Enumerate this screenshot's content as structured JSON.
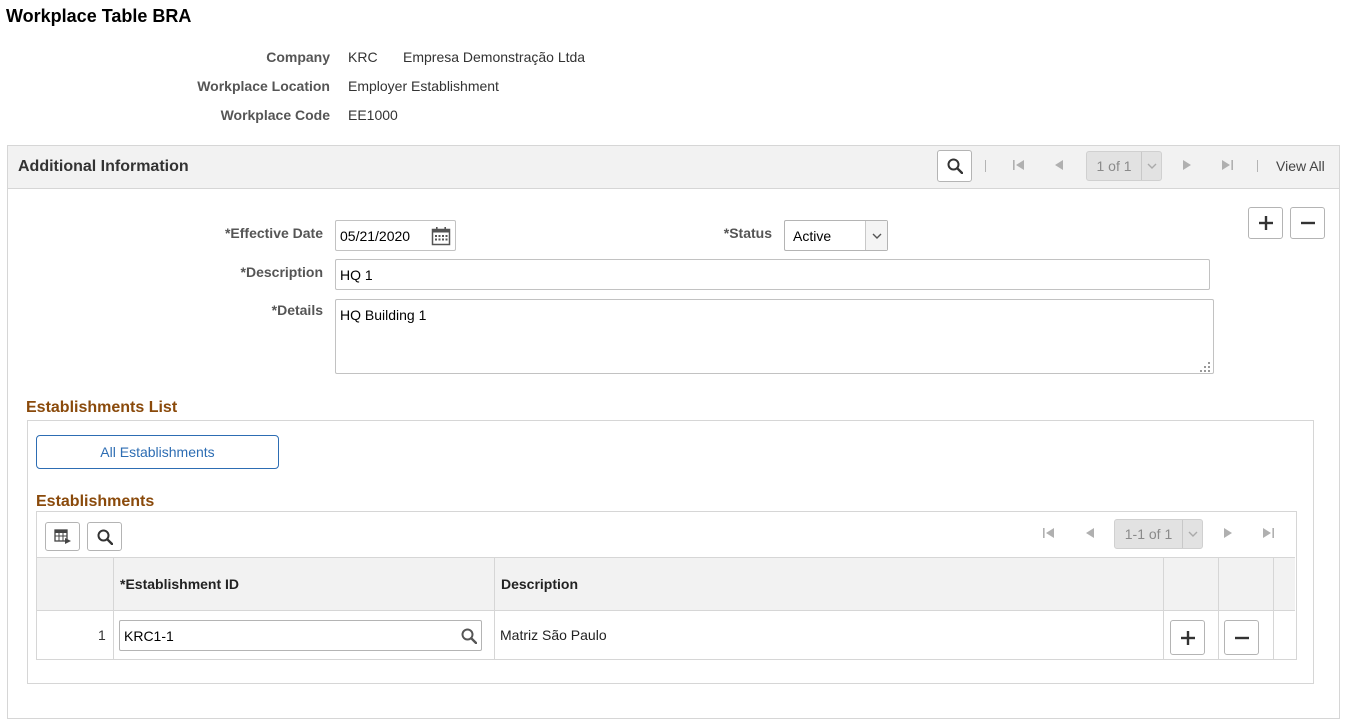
{
  "page": {
    "title": "Workplace Table BRA"
  },
  "header": {
    "company_label": "Company",
    "company_code": "KRC",
    "company_name": "Empresa Demonstração Ltda",
    "location_label": "Workplace Location",
    "location_value": "Employer Establishment",
    "code_label": "Workplace Code",
    "code_value": "EE1000"
  },
  "additional_info": {
    "title": "Additional Information",
    "pagination": "1 of 1",
    "view_all": "View All",
    "effective_date_label": "*Effective Date",
    "effective_date_value": "05/21/2020",
    "status_label": "*Status",
    "status_value": "Active",
    "description_label": "*Description",
    "description_value": "HQ 1",
    "details_label": "*Details",
    "details_value": "HQ Building 1"
  },
  "establishments_list": {
    "title": "Establishments List",
    "all_button": "All Establishments",
    "grid_title": "Establishments",
    "pagination": "1-1 of 1",
    "columns": [
      "*Establishment ID",
      "Description"
    ],
    "rows": [
      {
        "num": "1",
        "establishment_id": "KRC1-1",
        "description": "Matriz São Paulo"
      }
    ]
  },
  "colors": {
    "section_title": "#8a4a0b",
    "link": "#2d6db3",
    "header_bg": "#f2f2f2"
  }
}
